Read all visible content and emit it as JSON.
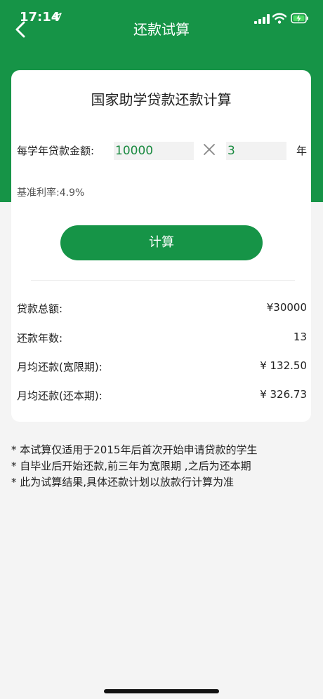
{
  "status_bar": {
    "time": "17:14"
  },
  "nav": {
    "title": "还款试算"
  },
  "card": {
    "title": "国家助学贷款还款计算",
    "annual_loan_label": "每学年贷款金额:",
    "annual_loan_value": "10000",
    "years_value": "3",
    "years_unit": "年",
    "rate_label": "基准利率:4.9%",
    "calc_button": "计算"
  },
  "results": [
    {
      "label": "贷款总额:",
      "value": "¥30000"
    },
    {
      "label": "还款年数:",
      "value": "13"
    },
    {
      "label": "月均还款(宽限期):",
      "value": "¥ 132.50"
    },
    {
      "label": "月均还款(还本期):",
      "value": "¥ 326.73"
    }
  ],
  "notes": [
    "* 本试算仅适用于2015年后首次开始申请贷款的学生",
    "* 自毕业后开始还款,前三年为宽限期 ,之后为还本期",
    "* 此为试算结果,具体还款计划以放款行计算为准"
  ],
  "colors": {
    "brand_green": "#169447",
    "input_text": "#1a8a40"
  },
  "icons": {
    "back": "chevron-left-icon",
    "multiply": "times-icon"
  }
}
